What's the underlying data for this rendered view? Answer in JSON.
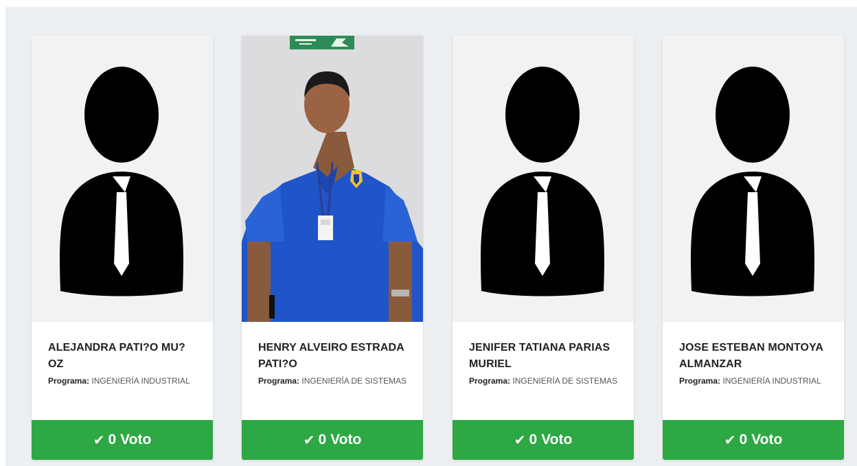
{
  "cards": [
    {
      "name": "ALEJANDRA PATI?O MU?OZ",
      "program_label": "Programa:",
      "program": "INGENIERÍA INDUSTRIAL",
      "photo": "default-avatar-icon",
      "votes": "0",
      "vote_label": "Voto"
    },
    {
      "name": "HENRY ALVEIRO ESTRADA PATI?O",
      "program_label": "Programa:",
      "program": "INGENIERÍA DE SISTEMAS",
      "photo": "candidate-photo",
      "votes": "0",
      "vote_label": "Voto"
    },
    {
      "name": "JENIFER TATIANA PARIAS MURIEL",
      "program_label": "Programa:",
      "program": "INGENIERÍA DE SISTEMAS",
      "photo": "default-avatar-icon",
      "votes": "0",
      "vote_label": "Voto"
    },
    {
      "name": "JOSE ESTEBAN MONTOYA ALMANZAR",
      "program_label": "Programa:",
      "program": "INGENIERÍA INDUSTRIAL",
      "photo": "default-avatar-icon",
      "votes": "0",
      "vote_label": "Voto"
    }
  ],
  "colors": {
    "vote_button": "#2ea745",
    "panel_bg": "#eceff2",
    "card_bg": "#ffffff"
  }
}
